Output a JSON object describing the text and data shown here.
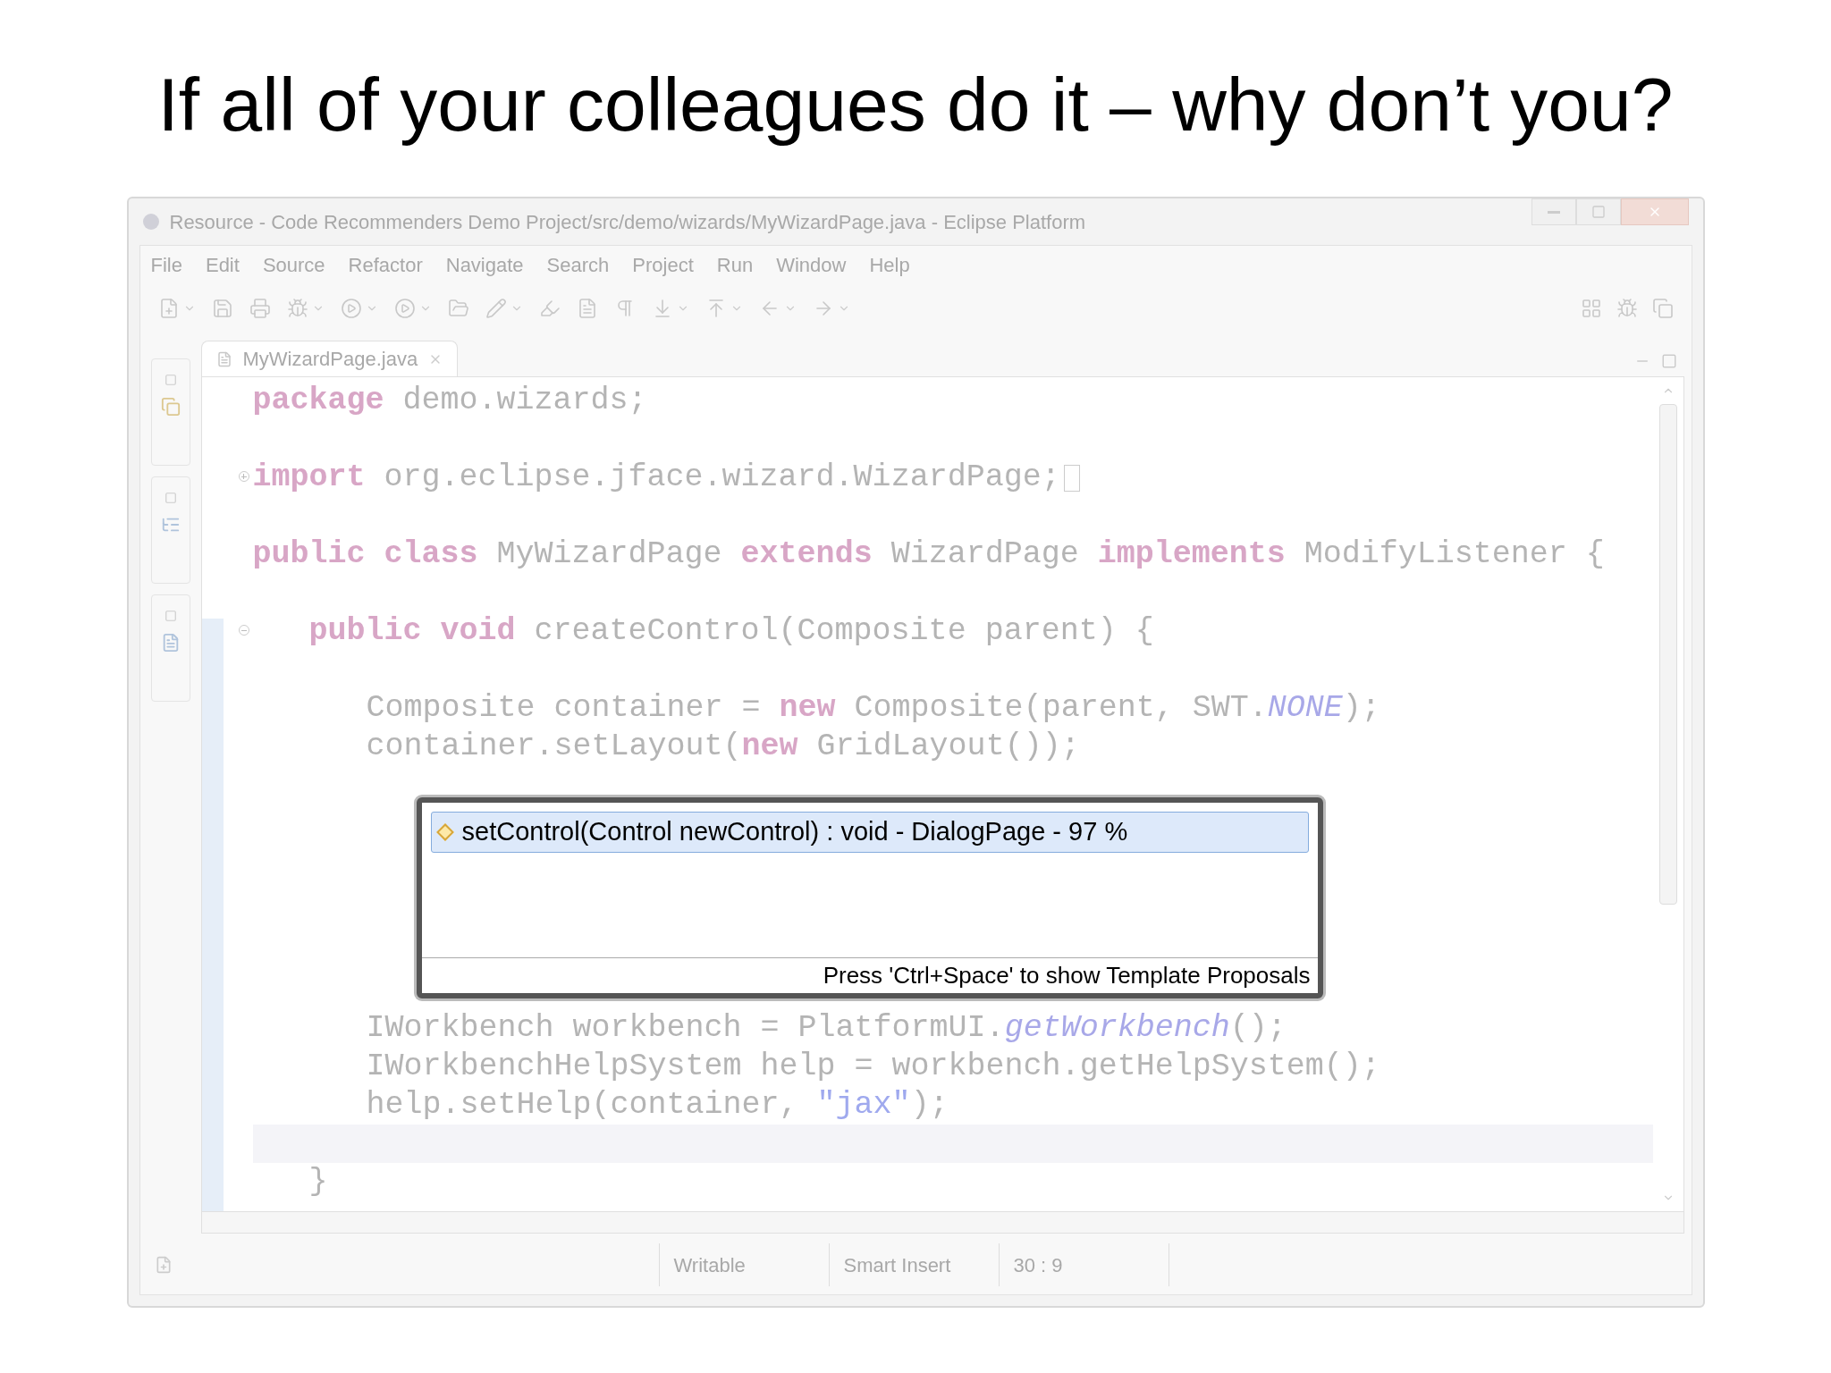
{
  "slide_title": "If all of your colleagues do it – why don’t you?",
  "window": {
    "title": "Resource - Code Recommenders Demo Project/src/demo/wizards/MyWizardPage.java - Eclipse Platform"
  },
  "menu": [
    "File",
    "Edit",
    "Source",
    "Refactor",
    "Navigate",
    "Search",
    "Project",
    "Run",
    "Window",
    "Help"
  ],
  "editor": {
    "tab": {
      "label": "MyWizardPage.java",
      "selected": true
    },
    "lines_above": [
      {
        "kind": "code",
        "segments": [
          {
            "kind": "keyword",
            "text": "package"
          },
          {
            "kind": "plain",
            "text": " demo.wizards;"
          }
        ]
      },
      {
        "kind": "blank"
      },
      {
        "kind": "code",
        "expanded": false,
        "segments": [
          {
            "kind": "keyword",
            "text": "import"
          },
          {
            "kind": "plain",
            "text": " org.eclipse.jface.wizard.WizardPage;"
          }
        ]
      },
      {
        "kind": "blank"
      },
      {
        "kind": "code",
        "segments": [
          {
            "kind": "keyword",
            "text": "public class"
          },
          {
            "kind": "plain",
            "text": " MyWizardPage "
          },
          {
            "kind": "keyword",
            "text": "extends"
          },
          {
            "kind": "plain",
            "text": " WizardPage "
          },
          {
            "kind": "keyword",
            "text": "implements"
          },
          {
            "kind": "plain",
            "text": " ModifyListener {"
          }
        ]
      },
      {
        "kind": "blank"
      },
      {
        "kind": "member",
        "expanded": true,
        "segments": [
          {
            "kind": "keyword",
            "text": "public void"
          },
          {
            "kind": "plain",
            "text": " createControl(Composite parent) {"
          }
        ]
      },
      {
        "kind": "blank"
      },
      {
        "kind": "body",
        "segments": [
          {
            "kind": "plain",
            "text": "Composite container = "
          },
          {
            "kind": "keyword",
            "text": "new"
          },
          {
            "kind": "plain",
            "text": " Composite(parent, SWT."
          },
          {
            "kind": "constant",
            "text": "NONE"
          },
          {
            "kind": "plain",
            "text": ");"
          }
        ]
      },
      {
        "kind": "body",
        "segments": [
          {
            "kind": "plain",
            "text": "container.setLayout("
          },
          {
            "kind": "keyword",
            "text": "new"
          },
          {
            "kind": "plain",
            "text": " GridLayout());"
          }
        ]
      }
    ],
    "lines_below": [
      {
        "kind": "body",
        "segments": [
          {
            "kind": "plain",
            "text": "IWorkbench workbench = PlatformUI."
          },
          {
            "kind": "constant",
            "text": "getWorkbench"
          },
          {
            "kind": "plain",
            "text": "();"
          }
        ]
      },
      {
        "kind": "body",
        "segments": [
          {
            "kind": "plain",
            "text": "IWorkbenchHelpSystem help = workbench.getHelpSystem();"
          }
        ]
      },
      {
        "kind": "body",
        "segments": [
          {
            "kind": "plain",
            "text": "help.setHelp(container, "
          },
          {
            "kind": "string",
            "text": "\"jax\""
          },
          {
            "kind": "plain",
            "text": ");"
          }
        ]
      },
      {
        "kind": "blank",
        "current": true
      },
      {
        "kind": "member",
        "segments": [
          {
            "kind": "plain",
            "text": "}"
          }
        ]
      }
    ]
  },
  "completion_popup": {
    "proposals": [
      {
        "label": "setControl(Control newControl) : void - DialogPage - 97 %",
        "selected": true
      }
    ],
    "footer": "Press 'Ctrl+Space' to show Template Proposals"
  },
  "status_bar": [
    "Writable",
    "Smart Insert",
    "30 : 9"
  ]
}
